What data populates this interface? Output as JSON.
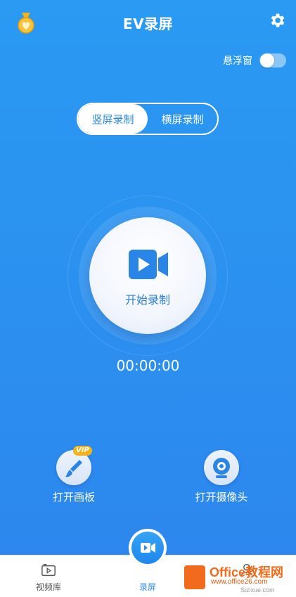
{
  "header": {
    "title": "EV录屏",
    "left_icon": "medal-icon",
    "right_icon": "gear-icon"
  },
  "floating_window": {
    "label": "悬浮窗",
    "enabled": false
  },
  "orientation_tabs": [
    {
      "label": "竖屏录制",
      "active": true
    },
    {
      "label": "横屏录制",
      "active": false
    }
  ],
  "record": {
    "label": "开始录制",
    "icon": "video-camera-icon",
    "timer": "00:00:00"
  },
  "tools": {
    "drawing_board": {
      "label": "打开画板",
      "badge": "VIP",
      "icon": "paintbrush-icon"
    },
    "camera": {
      "label": "打开摄像头",
      "icon": "webcam-icon"
    }
  },
  "bottom_nav": {
    "items": [
      {
        "label": "视频库",
        "icon": "video-library-icon"
      },
      {
        "label": "录屏",
        "icon": "video-camera-icon",
        "active": true
      },
      {
        "label": "",
        "icon": "person-icon"
      }
    ]
  },
  "watermark": {
    "brand": "Office教程网",
    "url": "www.office26.com",
    "sub": "Sizixue.com"
  },
  "colors": {
    "background_top": "#2a9af3",
    "background_bottom": "#2d87ee",
    "accent": "#2a8cf0",
    "vip": "#f6b319"
  }
}
